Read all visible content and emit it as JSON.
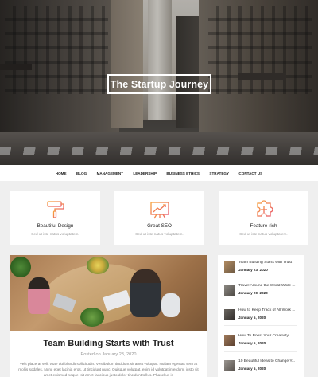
{
  "hero": {
    "title": "The Startup Journey"
  },
  "nav": {
    "items": [
      "HOME",
      "BLOG",
      "MANAGEMENT",
      "LEADERSHIP",
      "BUSINESS ETHICS",
      "STRATEGY",
      "CONTACT US"
    ]
  },
  "features": [
    {
      "title": "Beautiful Design",
      "desc": "Sed ut iste natus voluptatem.",
      "icon": "paint-roller-icon"
    },
    {
      "title": "Great SEO",
      "desc": "Sed ut iste natus voluptatem.",
      "icon": "chart-board-icon"
    },
    {
      "title": "Feature-rich",
      "desc": "Sed ut iste natus voluptatem.",
      "icon": "puzzle-icon"
    }
  ],
  "colors": {
    "accent_gradient_start": "#f7a33b",
    "accent_gradient_end": "#e8546a"
  },
  "post": {
    "title": "Team Building Starts with Trust",
    "date": "Posted on January 23, 2020",
    "excerpt": "Velit placerat velit vitae dui blandit sollicitudin. Vestibulum tincidunt sit amet volutpat. Nullam egestas sem at mollis sodales. Nunc eget lacinia eros, ut tincidunt nunc. Quisque volutpat, enim id volutpat interdum, justo sit amet euismod neque, sit amet faucibus justo dolor tincidunt tellus. Phasellus in"
  },
  "sidebar": {
    "items": [
      {
        "title": "Team Building Starts with Trust",
        "date": "January 23, 2020"
      },
      {
        "title": "Travel Around the World While ...",
        "date": "January 20, 2020"
      },
      {
        "title": "How to Keep Track of All Work ...",
        "date": "January 5, 2020"
      },
      {
        "title": "How To Boost Your Creativity",
        "date": "January 5, 2020"
      },
      {
        "title": "10 Beautiful Ideas to Change Y...",
        "date": "January 5, 2020"
      }
    ]
  }
}
